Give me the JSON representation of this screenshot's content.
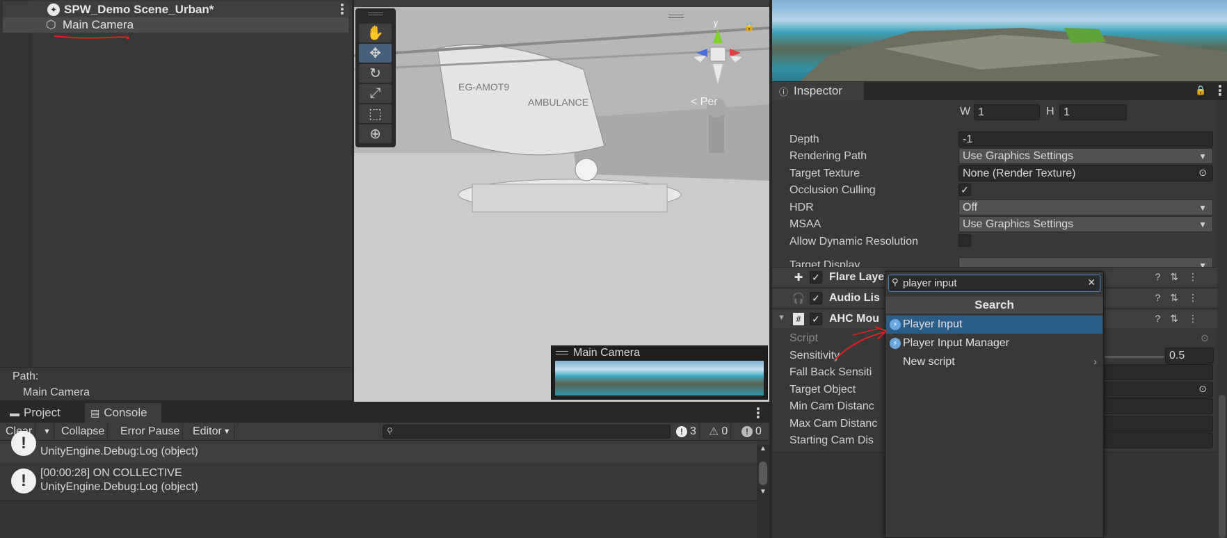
{
  "hierarchy": {
    "scene_name": "SPW_Demo Scene_Urban*",
    "selected_object": "Main Camera",
    "path_label": "Path:",
    "path_value": "Main Camera"
  },
  "scene_view": {
    "preview_title": "Main Camera",
    "gizmo_axis": "y",
    "gizmo_view": "< Per"
  },
  "console": {
    "tabs": [
      {
        "label": "Project",
        "icon": "folder-icon"
      },
      {
        "label": "Console",
        "icon": "console-icon"
      }
    ],
    "toolbar": {
      "clear": "Clear",
      "collapse": "Collapse",
      "error_pause": "Error Pause",
      "editor": "Editor",
      "info_count": "3",
      "warning_count": "0",
      "error_count": "0"
    },
    "logs": [
      {
        "line1": "",
        "line2": "UnityEngine.Debug:Log (object)"
      },
      {
        "line1": "[00:00:28] ON COLLECTIVE",
        "line2": "UnityEngine.Debug:Log (object)"
      }
    ]
  },
  "inspector": {
    "tab_label": "Inspector",
    "w_label": "W",
    "w_value": "1",
    "h_label": "H",
    "h_value": "1",
    "props": {
      "depth_label": "Depth",
      "depth_value": "-1",
      "rendering_path_label": "Rendering Path",
      "rendering_path_value": "Use Graphics Settings",
      "target_texture_label": "Target Texture",
      "target_texture_value": "None (Render Texture)",
      "occlusion_label": "Occlusion Culling",
      "hdr_label": "HDR",
      "hdr_value": "Off",
      "msaa_label": "MSAA",
      "msaa_value": "Use Graphics Settings",
      "dynamic_res_label": "Allow Dynamic Resolution",
      "target_display_label": "Target Display"
    },
    "components": {
      "flare": "Flare Laye",
      "audio": "Audio Lis",
      "ahc": "AHC Mou"
    },
    "ahc_props": {
      "script_label": "Script",
      "sensitivity_label": "Sensitivity",
      "sensitivity_value": "0.5",
      "fallback_label": "Fall Back Sensiti",
      "target_object_label": "Target Object",
      "min_cam_label": "Min Cam Distanc",
      "max_cam_label": "Max Cam Distanc",
      "starting_cam_label": "Starting Cam Dis"
    }
  },
  "popup": {
    "search_value": "player input",
    "title": "Search",
    "items": [
      {
        "label": "Player Input",
        "selected": true
      },
      {
        "label": "Player Input Manager",
        "selected": false
      },
      {
        "label": "New script",
        "selected": false
      }
    ]
  },
  "colors": {
    "selection": "#2c5d87",
    "accent": "#4b83c5",
    "annotation_red": "#e02020"
  }
}
